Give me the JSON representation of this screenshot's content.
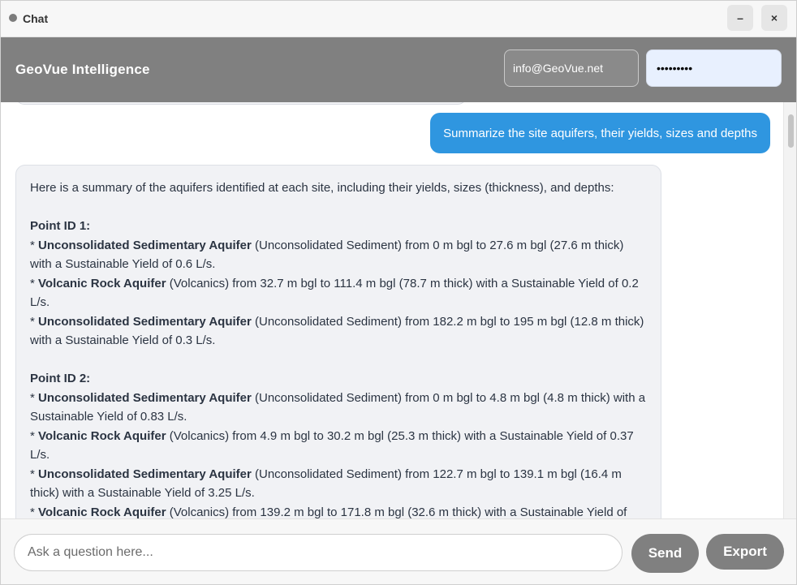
{
  "window": {
    "title": "Chat",
    "minimize_label": "–",
    "close_label": "×"
  },
  "header": {
    "brand": "GeoVue Intelligence",
    "email_value": "info@GeoVue.net",
    "password_mask": "•••••••••"
  },
  "chat": {
    "user_message": "Summarize the site aquifers, their yields, sizes and depths",
    "bot_intro": "Here is a summary of the aquifers identified at each site, including their yields, sizes (thickness), and depths:",
    "points": [
      {
        "title": "Point ID 1:",
        "aquifers": [
          {
            "bullet": "* ",
            "name": "Unconsolidated Sedimentary Aquifer",
            "details": " (Unconsolidated Sediment) from 0 m bgl to 27.6 m bgl (27.6 m thick) with a Sustainable Yield of 0.6 L/s."
          },
          {
            "bullet": "* ",
            "name": "Volcanic Rock Aquifer",
            "details": " (Volcanics) from 32.7 m bgl to 111.4 m bgl (78.7 m thick) with a Sustainable Yield of 0.2 L/s."
          },
          {
            "bullet": "* ",
            "name": "Unconsolidated Sedimentary Aquifer",
            "details": " (Unconsolidated Sediment) from 182.2 m bgl to 195 m bgl (12.8 m thick) with a Sustainable Yield of 0.3 L/s."
          }
        ]
      },
      {
        "title": "Point ID 2:",
        "aquifers": [
          {
            "bullet": "* ",
            "name": "Unconsolidated Sedimentary Aquifer",
            "details": " (Unconsolidated Sediment) from 0 m bgl to 4.8 m bgl (4.8 m thick) with a Sustainable Yield of 0.83 L/s."
          },
          {
            "bullet": "* ",
            "name": "Volcanic Rock Aquifer",
            "details": " (Volcanics) from 4.9 m bgl to 30.2 m bgl (25.3 m thick) with a Sustainable Yield of 0.37 L/s."
          },
          {
            "bullet": "* ",
            "name": "Unconsolidated Sedimentary Aquifer",
            "details": " (Unconsolidated Sediment) from 122.7 m bgl to 139.1 m bgl (16.4 m thick) with a Sustainable Yield of 3.25 L/s."
          },
          {
            "bullet": "* ",
            "name": "Volcanic Rock Aquifer",
            "details": " (Volcanics) from 139.2 m bgl to 171.8 m bgl (32.6 m thick) with a Sustainable Yield of"
          }
        ]
      }
    ]
  },
  "footer": {
    "input_placeholder": "Ask a question here...",
    "send_label": "Send",
    "export_label": "Export"
  },
  "colors": {
    "header_bg": "#808080",
    "user_bubble": "#2f96e0",
    "bot_bubble": "#f1f2f5",
    "button_bg": "#808080"
  }
}
